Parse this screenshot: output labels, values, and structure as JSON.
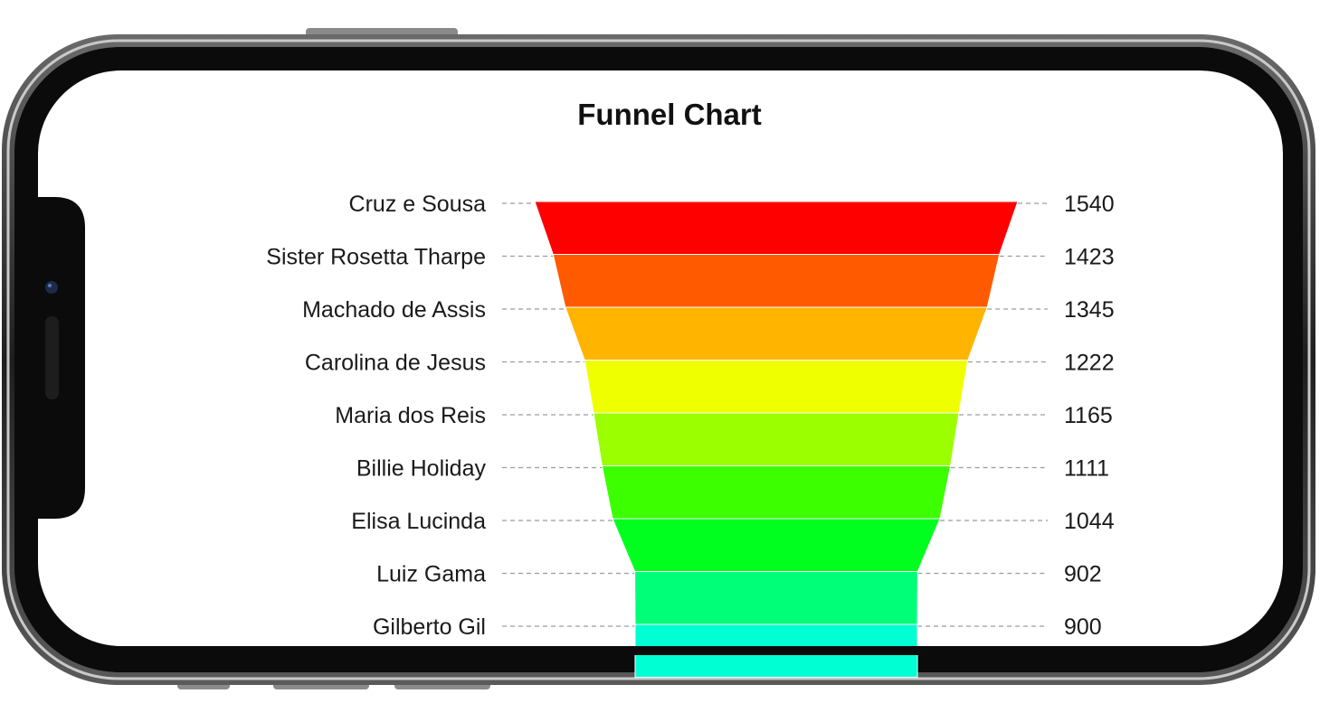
{
  "colors": {
    "frame_outer": "#2b2b2b",
    "frame_bezel": "#0b0b0b",
    "screen_bg": "#ffffff",
    "leader": "#9a9aa8",
    "text": "#1a1a1a"
  },
  "chart_data": {
    "type": "funnel",
    "title": "Funnel Chart",
    "categories": [
      "Cruz e Sousa",
      "Sister Rosetta Tharpe",
      "Machado de Assis",
      "Carolina de Jesus",
      "Maria dos Reis",
      "Billie Holiday",
      "Elisa Lucinda",
      "Luiz Gama",
      "Gilberto Gil"
    ],
    "values": [
      1540,
      1423,
      1345,
      1222,
      1165,
      1111,
      1044,
      902,
      900
    ],
    "colors": [
      "#ff0000",
      "#ff5a00",
      "#ffb400",
      "#f0ff00",
      "#9bff00",
      "#3cff00",
      "#00ff1e",
      "#00ff78",
      "#00ffd2"
    ]
  }
}
